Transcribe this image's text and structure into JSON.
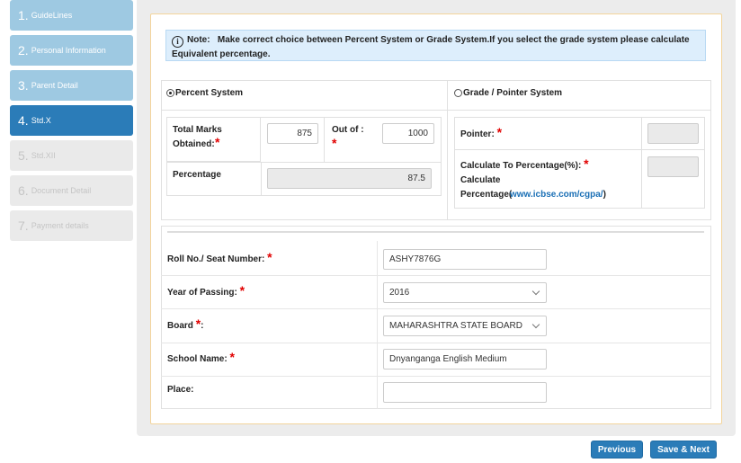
{
  "sidebar": {
    "steps": [
      {
        "num": "1.",
        "label": "GuideLines",
        "state": "done"
      },
      {
        "num": "2.",
        "label": "Personal Information",
        "state": "done"
      },
      {
        "num": "3.",
        "label": "Parent Detail",
        "state": "done"
      },
      {
        "num": "4.",
        "label": "Std.X",
        "state": "active"
      },
      {
        "num": "5.",
        "label": "Std.XII",
        "state": "todo"
      },
      {
        "num": "6.",
        "label": "Document Detail",
        "state": "todo"
      },
      {
        "num": "7.",
        "label": "Payment details",
        "state": "todo"
      }
    ]
  },
  "note": {
    "icon": "info-icon",
    "prefix": "Note:",
    "text": "Make correct choice between Percent System or Grade System.If you select the grade system please calculate Equivalent percentage."
  },
  "percent_system": {
    "label": "Percent System",
    "selected": true,
    "total_marks_label": "Total Marks Obtained:",
    "total_marks_value": "875",
    "out_of_label": "Out of :",
    "out_of_value": "1000",
    "percentage_label": "Percentage",
    "percentage_value": "87.5"
  },
  "grade_system": {
    "label": "Grade / Pointer System",
    "selected": false,
    "pointer_label": "Pointer:",
    "pointer_value": "",
    "calc_label": "Calculate To Percentage(%):",
    "calc_value": "",
    "calc_link_prefix": "Calculate Percentage(",
    "calc_link_text": "www.icbse.com/cgpa/",
    "calc_link_suffix": ")"
  },
  "form": {
    "roll_label": "Roll No./ Seat Number:",
    "roll_value": "ASHY7876G",
    "year_label": "Year of Passing:",
    "year_value": "2016",
    "board_label": "Board",
    "board_suffix": ":",
    "board_value": "MAHARASHTRA STATE BOARD",
    "school_label": "School Name:",
    "school_value": "Dnyanganga English Medium",
    "place_label": "Place:",
    "place_value": ""
  },
  "required_mark": "*",
  "buttons": {
    "previous": "Previous",
    "save_next": "Save & Next"
  },
  "colors": {
    "accent": "#2b7cb8",
    "done_step": "#9ec9e2",
    "required": "#e10000"
  }
}
